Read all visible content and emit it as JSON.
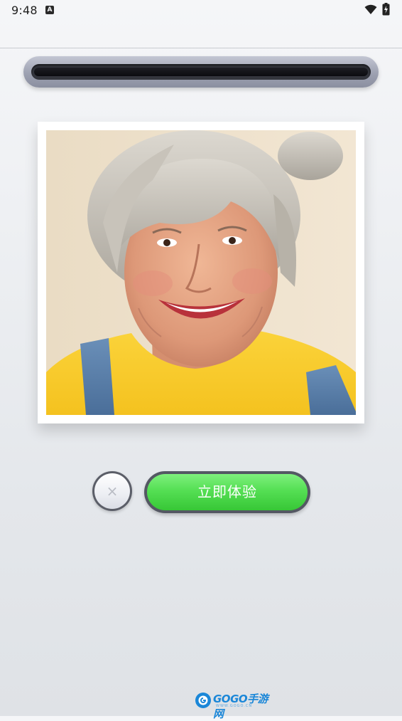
{
  "status_bar": {
    "time": "9:48",
    "notification_icon": "a-letter-icon",
    "notification_letter": "A",
    "wifi_icon": "wifi-icon",
    "battery_icon": "battery-charging-icon"
  },
  "progress": {
    "fraction": 1.0
  },
  "photo": {
    "subject": "smiling-elderly-woman-portrait",
    "icon": "portrait-photo"
  },
  "actions": {
    "close_glyph": "×",
    "close_icon": "close-icon",
    "primary_label": "立即体验"
  },
  "watermark": {
    "brand": "GOGO手游网",
    "url": "WWW.GOGO.CN",
    "logo_icon": "gogo-logo-icon"
  },
  "colors": {
    "cta_green": "#55df54",
    "progress_dark": "#0b0b0f",
    "watermark_blue": "#1b87d8"
  }
}
